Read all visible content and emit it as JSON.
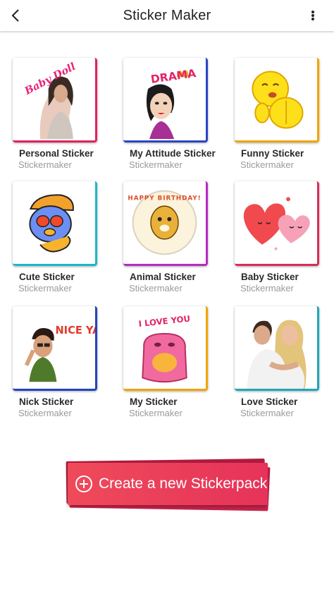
{
  "app_bar": {
    "title": "Sticker Maker",
    "back_icon": "chevron-left-icon",
    "menu_icon": "more-vertical-icon"
  },
  "packs": [
    {
      "title": "Personal Sticker",
      "subtitle": "Stickermaker",
      "border_color": "#e0245e",
      "art_text": "Baby Doll"
    },
    {
      "title": "My Attitude Sticker",
      "subtitle": "Stickermaker",
      "border_color": "#2a46c4",
      "art_text": "DRAMA"
    },
    {
      "title": "Funny Sticker",
      "subtitle": "Stickermaker",
      "border_color": "#f0a500",
      "art_text": ""
    },
    {
      "title": "Cute Sticker",
      "subtitle": "Stickermaker",
      "border_color": "#1fb5c9",
      "art_text": ""
    },
    {
      "title": "Animal Sticker",
      "subtitle": "Stickermaker",
      "border_color": "#b62bc2",
      "art_text": "HAPPY BIRTHDAY!"
    },
    {
      "title": "Baby Sticker",
      "subtitle": "Stickermaker",
      "border_color": "#d92d57",
      "art_text": ""
    },
    {
      "title": "Nick Sticker",
      "subtitle": "Stickermaker",
      "border_color": "#2346b8",
      "art_text": "NICE YAA"
    },
    {
      "title": "My Sticker",
      "subtitle": "Stickermaker",
      "border_color": "#f0a500",
      "art_text": "I LOVE YOU"
    },
    {
      "title": "Love Sticker",
      "subtitle": "Stickermaker",
      "border_color": "#1fa7b8",
      "art_text": ""
    }
  ],
  "create_button": {
    "label": "Create a new Stickerpack",
    "icon": "plus-circle-icon",
    "color": "#ea3f5b"
  }
}
